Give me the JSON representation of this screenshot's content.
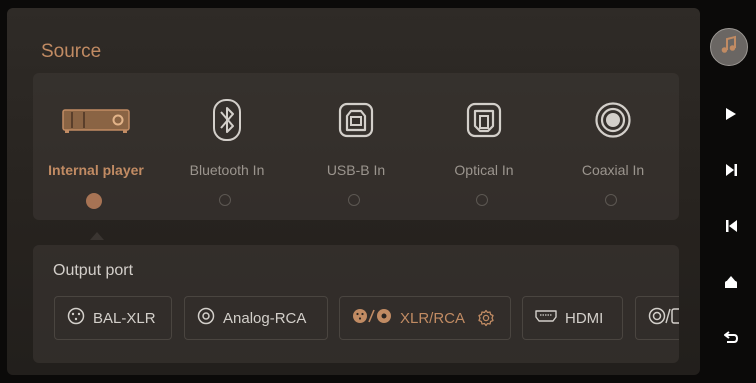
{
  "header": {
    "title": "Source"
  },
  "sources": [
    {
      "label": "Internal player",
      "icon": "internal-player-icon",
      "selected": true
    },
    {
      "label": "Bluetooth In",
      "icon": "bluetooth-icon",
      "selected": false
    },
    {
      "label": "USB-B In",
      "icon": "usb-b-icon",
      "selected": false
    },
    {
      "label": "Optical In",
      "icon": "optical-icon",
      "selected": false
    },
    {
      "label": "Coaxial In",
      "icon": "coaxial-icon",
      "selected": false
    }
  ],
  "output": {
    "title": "Output port",
    "ports": [
      {
        "label": "BAL-XLR",
        "icon": "xlr-icon",
        "selected": false
      },
      {
        "label": "Analog-RCA",
        "icon": "rca-icon",
        "selected": false
      },
      {
        "label": "XLR/RCA",
        "icon": "xlr-rca-icon",
        "selected": true,
        "has_settings": true
      },
      {
        "label": "HDMI",
        "icon": "hdmi-icon",
        "selected": false
      },
      {
        "label": "",
        "icon": "coaxial-optical-icon",
        "selected": false
      }
    ]
  },
  "sidebar": {
    "buttons": [
      "music-icon",
      "play-icon",
      "next-track-icon",
      "previous-track-icon",
      "eject-icon",
      "back-icon"
    ]
  },
  "colors": {
    "accent": "#c18b63",
    "text": "#d3cfca",
    "muted": "#9b958e",
    "background": "#0b0a09"
  }
}
